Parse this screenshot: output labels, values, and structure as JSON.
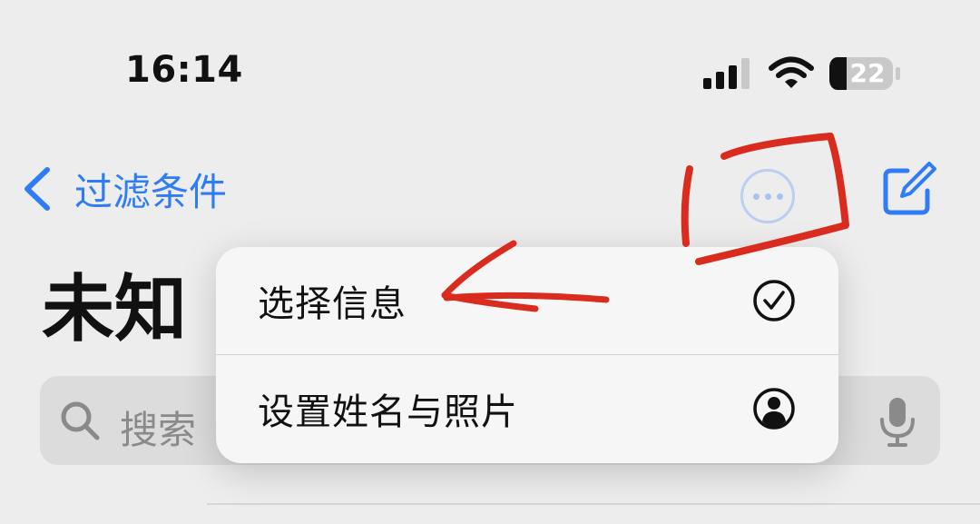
{
  "status_bar": {
    "time": "16:14",
    "battery_level": "22",
    "signal_icon": "signal-icon",
    "wifi_icon": "wifi-icon",
    "battery_icon": "battery-icon"
  },
  "nav": {
    "back_label": "过滤条件",
    "back_icon": "chevron-left-icon",
    "more_icon": "ellipsis-circle-icon",
    "compose_icon": "compose-icon"
  },
  "page": {
    "title": "未知"
  },
  "search": {
    "placeholder": "搜索",
    "icon": "search-icon",
    "mic_icon": "mic-icon"
  },
  "menu": {
    "items": [
      {
        "label": "选择信息",
        "icon": "checkmark-circle-icon"
      },
      {
        "label": "设置姓名与照片",
        "icon": "person-circle-icon"
      }
    ]
  },
  "colors": {
    "accent": "#2f7cf6",
    "annotation": "#d92b1e",
    "background": "#ededed"
  }
}
